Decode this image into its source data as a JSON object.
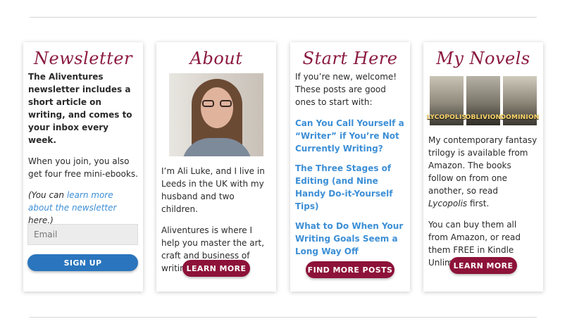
{
  "newsletter": {
    "title": "Newsletter",
    "intro": "The Aliventures newsletter includes a short article on writing, and comes to your inbox every week.",
    "join": "When you join, you also get four free mini-ebooks.",
    "note_prefix": "(You can ",
    "note_link": "learn more about the newsletter",
    "note_suffix": " here.)",
    "email_placeholder": "Email",
    "button": "SIGN UP"
  },
  "about": {
    "title": "About",
    "photo_icon": "author-photo",
    "para1": "I’m Ali Luke, and I live in Leeds in the UK with my husband and two children.",
    "para2": "Aliventures is where I help you master the art, craft and business of writing.",
    "button": "LEARN MORE"
  },
  "start_here": {
    "title": "Start Here",
    "intro": "If you’re new, welcome! These posts are good ones to start with:",
    "links": [
      "Can You Call Yourself a “Writer” if You’re Not Currently Writing?",
      "The Three Stages of Editing (and Nine Handy Do-it-Yourself Tips)",
      "What to Do When Your Writing Goals Seem a Long Way Off"
    ],
    "button": "FIND MORE POSTS"
  },
  "novels": {
    "title": "My Novels",
    "books": [
      "LYCOPOLIS",
      "OBLIVION",
      "DOMINION"
    ],
    "para1_prefix": "My contemporary fantasy trilogy is available from Amazon. The books follow on from one another, so read ",
    "para1_em": "Lycopolis",
    "para1_suffix": " first.",
    "para2": "You can buy them all from Amazon, or read them FREE in Kindle Unlimited.",
    "button": "LEARN MORE"
  },
  "colors": {
    "heading": "#8b1a3f",
    "link": "#3d8fd6",
    "button_red": "#8d1239",
    "button_blue": "#2a75bd"
  }
}
